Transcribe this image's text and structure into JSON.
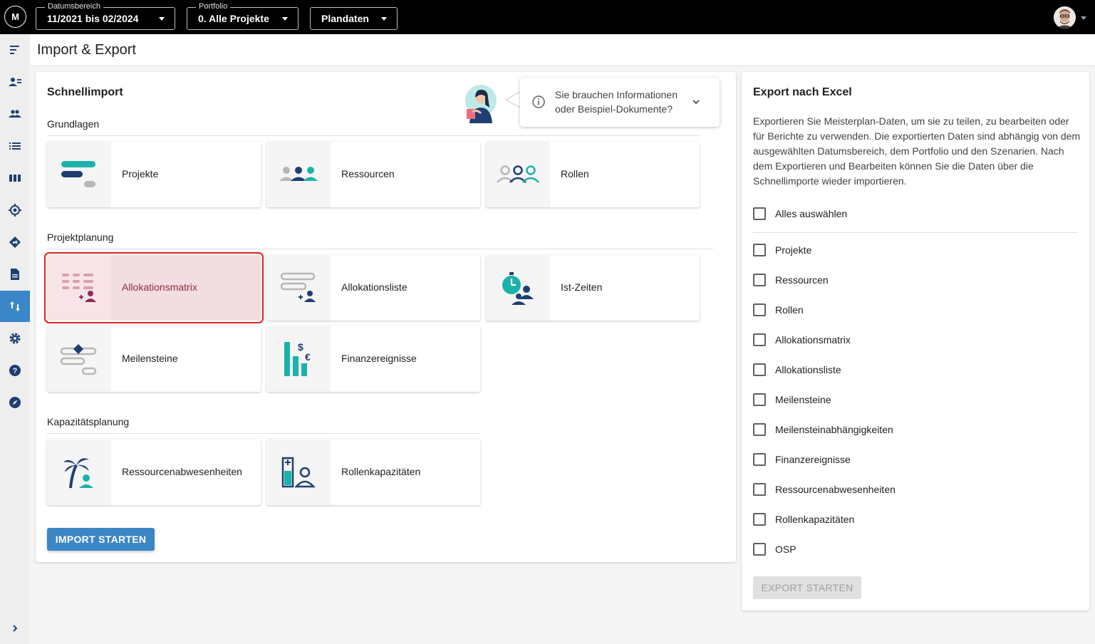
{
  "topbar": {
    "logo_text": "M",
    "date_range": {
      "legend": "Datumsbereich",
      "value": "11/2021 bis 02/2024"
    },
    "portfolio": {
      "legend": "Portfolio",
      "value": "0. Alle Projekte"
    },
    "plandaten": {
      "value": "Plandaten"
    }
  },
  "sidebar": {
    "items": [
      "menu-collapse-icon",
      "person-list-icon",
      "people-icon",
      "list-icon",
      "columns-icon",
      "target-icon",
      "direction-icon",
      "document-icon",
      "import-export-icon",
      "settings-icon",
      "help-icon",
      "compass-icon"
    ],
    "active": "import-export-icon"
  },
  "page": {
    "title": "Import & Export"
  },
  "schnellimport": {
    "title": "Schnellimport",
    "info_text": "Sie brauchen Informationen oder Beispiel-Dokumente?",
    "sections": {
      "grundlagen": {
        "label": "Grundlagen",
        "tiles": [
          "Projekte",
          "Ressourcen",
          "Rollen"
        ]
      },
      "projektplanung": {
        "label": "Projektplanung",
        "tiles": [
          "Allokationsmatrix",
          "Allokationsliste",
          "Ist-Zeiten",
          "Meilensteine",
          "Finanzereignisse"
        ]
      },
      "kapazitaetsplanung": {
        "label": "Kapazitätsplanung",
        "tiles": [
          "Ressourcenabwesenheiten",
          "Rollenkapazitäten"
        ]
      }
    },
    "selected_tile": "Allokationsmatrix",
    "button": "IMPORT STARTEN"
  },
  "export": {
    "title": "Export nach Excel",
    "description": "Exportieren Sie Meisterplan-Daten, um sie zu teilen, zu bearbeiten oder für Berichte zu verwenden. Die exportierten Daten sind abhängig von dem ausgewählten Datumsbereich, dem Portfolio und den Szenarien. Nach dem Exportieren und Bearbeiten können Sie die Daten über die Schnellimporte wieder importieren.",
    "select_all": "Alles auswählen",
    "options": [
      "Projekte",
      "Ressourcen",
      "Rollen",
      "Allokationsmatrix",
      "Allokationsliste",
      "Meilensteine",
      "Meilensteinabhängigkeiten",
      "Finanzereignisse",
      "Ressourcenabwesenheiten",
      "Rollenkapazitäten",
      "OSP"
    ],
    "button": "EXPORT STARTEN"
  },
  "colors": {
    "accent": "#3b86c7",
    "teal": "#1bb3a9",
    "navy": "#1d3f72",
    "gray_icon": "#b7b7b7",
    "selection": "#e02020"
  }
}
